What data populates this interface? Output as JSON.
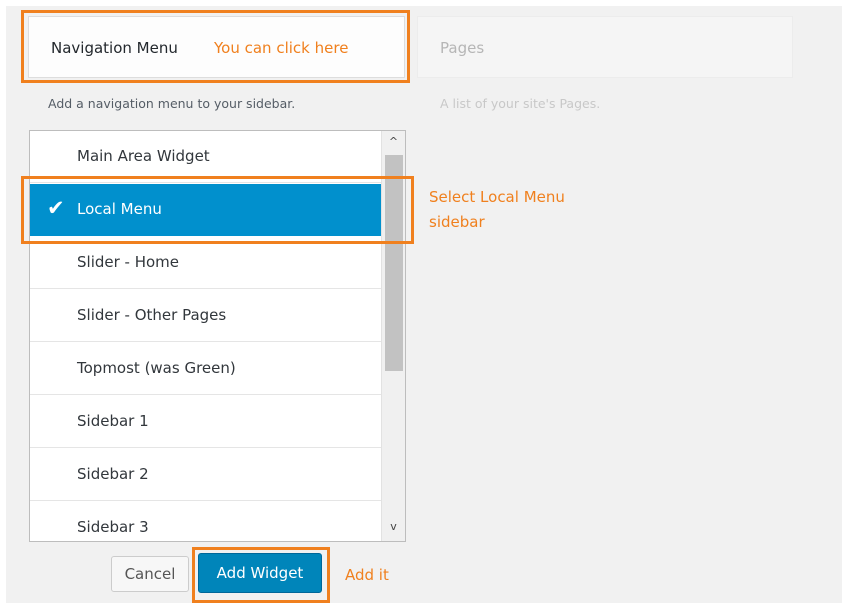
{
  "widgets": {
    "navigation_menu": {
      "title": "Navigation Menu",
      "description": "Add a navigation menu to your sidebar."
    },
    "pages": {
      "title": "Pages",
      "description": "A list of your site's Pages."
    }
  },
  "sidebar_list": {
    "items": [
      {
        "label": "Main Area Widget",
        "selected": false
      },
      {
        "label": "Local Menu",
        "selected": true
      },
      {
        "label": "Slider - Home",
        "selected": false
      },
      {
        "label": "Slider - Other Pages",
        "selected": false
      },
      {
        "label": "Topmost (was Green)",
        "selected": false
      },
      {
        "label": "Sidebar 1",
        "selected": false
      },
      {
        "label": "Sidebar 2",
        "selected": false
      },
      {
        "label": "Sidebar 3",
        "selected": false
      }
    ],
    "check_icon": "✔",
    "scroll_up_icon": "^",
    "scroll_down_icon": "v"
  },
  "actions": {
    "cancel_label": "Cancel",
    "add_widget_label": "Add Widget"
  },
  "annotations": {
    "click_here": "You can click here",
    "select_local_menu_line1": "Select Local Menu",
    "select_local_menu_line2": "sidebar",
    "add_it": "Add it"
  },
  "colors": {
    "accent_annotation": "#f0801e",
    "selected_background": "#0190cd",
    "primary_button": "#0085ba"
  }
}
